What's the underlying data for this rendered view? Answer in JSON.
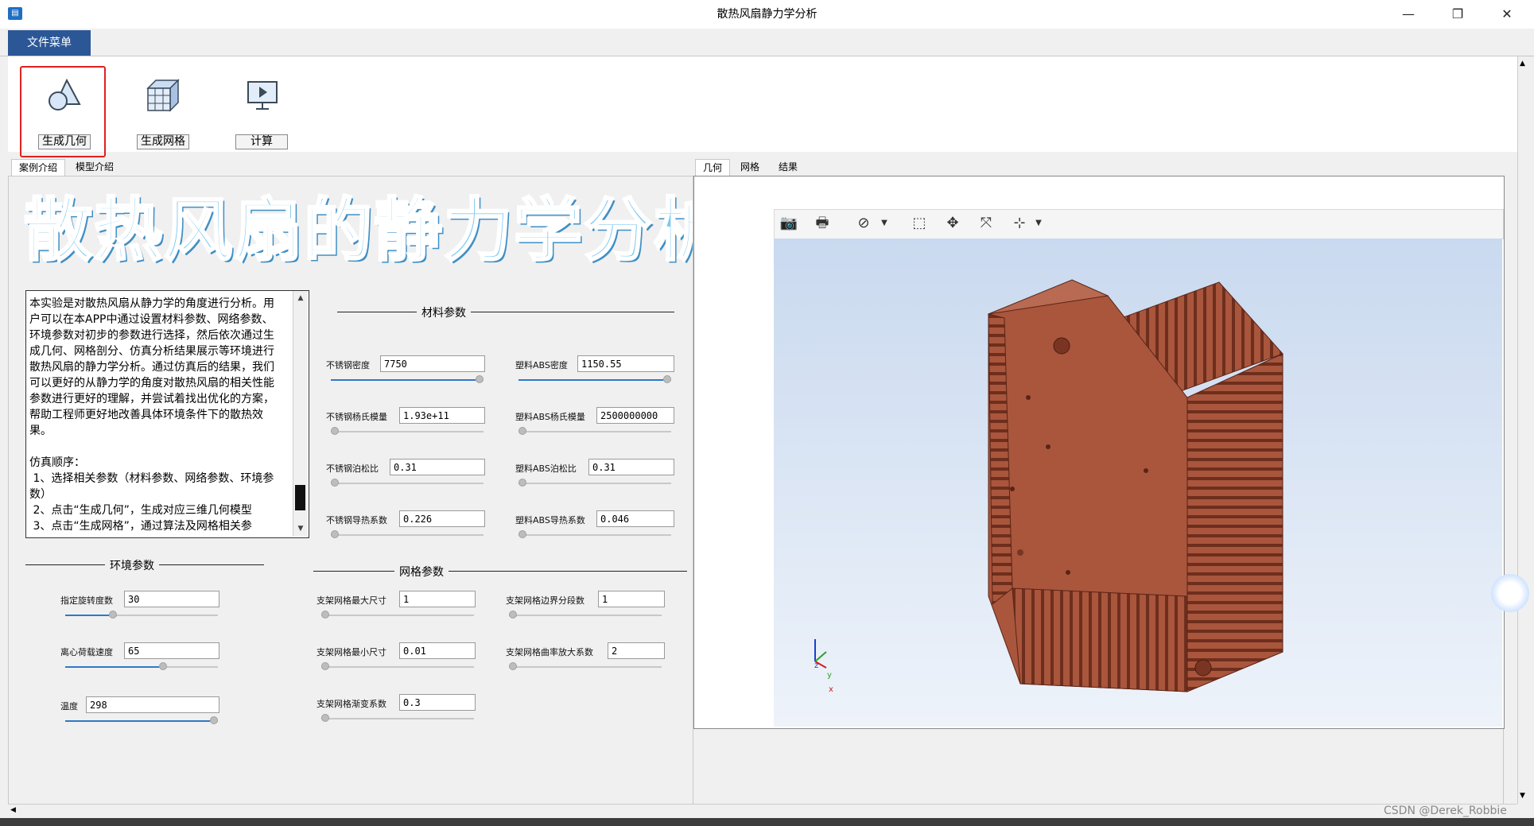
{
  "window": {
    "title": "散热风扇静力学分析",
    "icon": "app-icon",
    "minimize": "—",
    "restore": "❐",
    "close": "✕"
  },
  "menu": {
    "file_menu": "文件菜单"
  },
  "ribbon": {
    "buttons": [
      {
        "label": "生成几何",
        "icon": "geometry-icon"
      },
      {
        "label": "生成网格",
        "icon": "mesh-icon"
      },
      {
        "label": "计算",
        "icon": "compute-icon"
      }
    ]
  },
  "left_tabs": [
    "案例介绍",
    "模型介绍"
  ],
  "right_tabs": [
    "几何",
    "网格",
    "结果"
  ],
  "banner": "散热风扇的静力学分析",
  "intro": {
    "text": "本实验是对散热风扇从静力学的角度进行分析。用户可以在本APP中通过设置材料参数、网络参数、环境参数对初步的参数进行选择，然后依次通过生成几何、网格剖分、仿真分析结果展示等环境进行散热风扇的静力学分析。通过仿真后的结果，我们可以更好的从静力学的角度对散热风扇的相关性能参数进行更好的理解，并尝试着找出优化的方案，帮助工程师更好地改善具体环境条件下的散热效果。\n\n仿真顺序：\n 1、选择相关参数（材料参数、网络参数、环境参数）\n 2、点击“生成几何”，生成对应三维几何模型\n 3、点击“生成网格”，通过算法及网格相关参"
  },
  "material": {
    "title": "材料参数",
    "fields": [
      {
        "label": "不锈钢密度",
        "value": "7750",
        "slider": 1.0
      },
      {
        "label": "塑料ABS密度",
        "value": "1150.55",
        "slider": 1.0
      },
      {
        "label": "不锈钢杨氏模量",
        "value": "1.93e+11",
        "slider": 0.0
      },
      {
        "label": "塑料ABS杨氏模量",
        "value": "2500000000",
        "slider": 0.0
      },
      {
        "label": "不锈钢泊松比",
        "value": "0.31",
        "slider": 0.0
      },
      {
        "label": "塑料ABS泊松比",
        "value": "0.31",
        "slider": 0.0
      },
      {
        "label": "不锈钢导热系数",
        "value": "0.226",
        "slider": 0.0
      },
      {
        "label": "塑料ABS导热系数",
        "value": "0.046",
        "slider": 0.0
      }
    ]
  },
  "environment": {
    "title": "环境参数",
    "fields": [
      {
        "label": "指定旋转度数",
        "value": "30",
        "slider": 0.3
      },
      {
        "label": "离心荷载速度",
        "value": "65",
        "slider": 0.65
      },
      {
        "label": "温度",
        "value": "298",
        "slider": 1.0
      }
    ]
  },
  "mesh": {
    "title": "网格参数",
    "fields": [
      {
        "label": "支架网格最大尺寸",
        "value": "1",
        "slider": 0.0
      },
      {
        "label": "支架网格边界分段数",
        "value": "1",
        "slider": 0.0
      },
      {
        "label": "支架网格最小尺寸",
        "value": "0.01",
        "slider": 0.0
      },
      {
        "label": "支架网格曲率放大系数",
        "value": "2",
        "slider": 0.0
      },
      {
        "label": "支架网格渐变系数",
        "value": "0.3",
        "slider": 0.0
      }
    ]
  },
  "viewer": {
    "toolbar": [
      "camera-icon",
      "print-icon",
      "hide-icon",
      "zoom-box-icon",
      "fit-view-icon",
      "zoom-extents-icon",
      "axis-orient-icon"
    ],
    "axes": {
      "x": "x",
      "y": "y",
      "z": "z"
    },
    "model_color": "#a9563d"
  },
  "watermark": "CSDN @Derek_Robbie"
}
